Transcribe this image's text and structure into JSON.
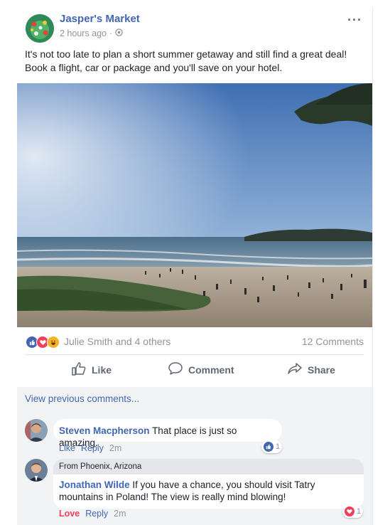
{
  "post": {
    "page_name": "Jasper's Market",
    "time": "2 hours ago",
    "separator": "·",
    "privacy_icon": "globe-icon",
    "more_label": "···",
    "text": "It's not too late to plan a short summer getaway and still find a great deal! Book a flight, car or package and you'll save on your hotel."
  },
  "reactions": {
    "icons": [
      "like-icon",
      "love-icon",
      "haha-icon"
    ],
    "names": "Julie Smith and 4 others",
    "comment_count": "12 Comments"
  },
  "actions": {
    "like": "Like",
    "comment": "Comment",
    "share": "Share"
  },
  "comments": {
    "view_previous": "View previous comments...",
    "items": [
      {
        "author": "Steven Macpherson",
        "text": "That place is just so amazing.",
        "like": "Like",
        "reply": "Reply",
        "time": "2m",
        "reaction_count": "1",
        "reaction_icon": "like-icon"
      },
      {
        "location": "From Phoenix, Arizona",
        "author": "Jonathan Wilde",
        "text": "If you have a chance, you should visit Tatry mountains in Poland! The view is really mind blowing!",
        "like": "Love",
        "reply": "Reply",
        "time": "2m",
        "reaction_count": "1",
        "reaction_icon": "love-icon"
      }
    ]
  },
  "colors": {
    "brand_blue": "#4267b2",
    "love_red": "#f33e58",
    "meta_gray": "#90949c"
  }
}
